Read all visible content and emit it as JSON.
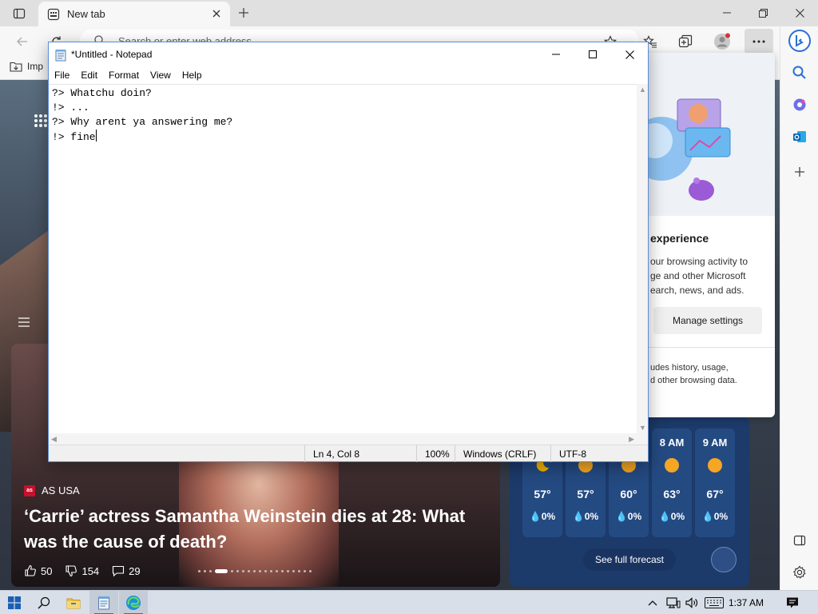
{
  "browser": {
    "tab": {
      "title": "New tab"
    },
    "address_placeholder": "Search or enter web address",
    "favorites": {
      "item": "Imp"
    }
  },
  "ntp": {
    "news": {
      "source": "AS USA",
      "source_logo": "as",
      "title": "‘Carrie’ actress Samantha Weinstein dies at 28: What was the cause of death?",
      "likes": "50",
      "dislikes": "154",
      "comments": "29"
    },
    "weather": {
      "hours": [
        {
          "time": "",
          "icon": "moon-icon",
          "temp": "57°",
          "precip": "0%"
        },
        {
          "time": "",
          "icon": "sun-icon",
          "temp": "57°",
          "precip": "0%"
        },
        {
          "time": "",
          "icon": "sun-icon",
          "temp": "60°",
          "precip": "0%"
        },
        {
          "time": "8 AM",
          "icon": "sun-icon",
          "temp": "63°",
          "precip": "0%"
        },
        {
          "time": "9 AM",
          "icon": "sun-icon",
          "temp": "67°",
          "precip": "0%"
        }
      ],
      "full_forecast_label": "See full forecast"
    }
  },
  "promo": {
    "heading": "experience",
    "body_lines": [
      "our browsing activity to",
      "ge and other Microsoft",
      "earch, news, and ads."
    ],
    "manage_settings_label": "Manage settings",
    "footnote_lines": [
      "udes history, usage,",
      "d other browsing data."
    ]
  },
  "notepad": {
    "title": "*Untitled - Notepad",
    "menus": [
      "File",
      "Edit",
      "Format",
      "View",
      "Help"
    ],
    "lines": [
      "?> Whatchu doin?",
      "!> ...",
      "?> Why arent ya answering me?",
      "!> fine"
    ],
    "status": {
      "position": "Ln 4, Col 8",
      "zoom": "100%",
      "line_ending": "Windows (CRLF)",
      "encoding": "UTF-8"
    }
  },
  "taskbar": {
    "time": "1:37 AM"
  },
  "colors": {
    "accent": "#3b6cc4",
    "notepad_border": "#5b8bd8",
    "weather_bg": "#1c3a6a"
  }
}
